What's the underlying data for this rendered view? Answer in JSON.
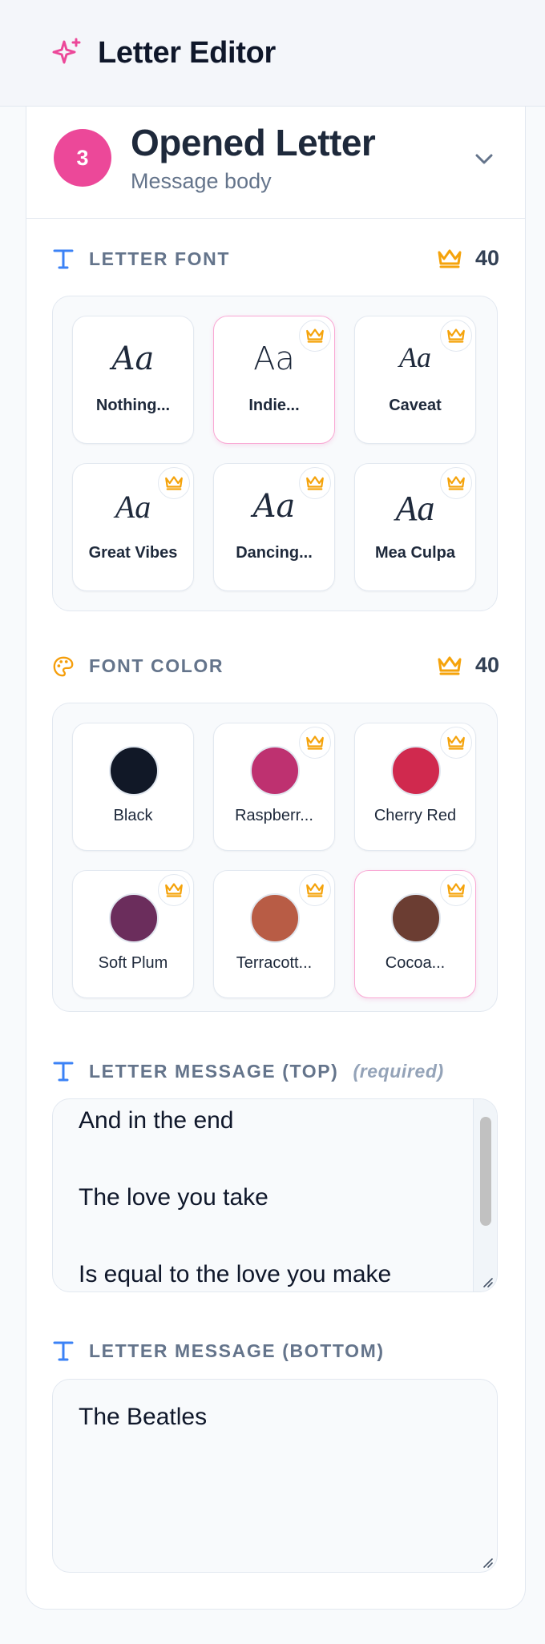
{
  "header": {
    "title": "Letter Editor"
  },
  "section": {
    "step": "3",
    "title": "Opened Letter",
    "subtitle": "Message body"
  },
  "font_group": {
    "label": "LETTER FONT",
    "cost": "40",
    "fonts": [
      {
        "sample": "Aa",
        "name": "Nothing...",
        "premium": false,
        "selected": false
      },
      {
        "sample": "Aa",
        "name": "Indie...",
        "premium": true,
        "selected": true
      },
      {
        "sample": "Aa",
        "name": "Caveat",
        "premium": true,
        "selected": false
      },
      {
        "sample": "Aa",
        "name": "Great Vibes",
        "premium": true,
        "selected": false
      },
      {
        "sample": "Aa",
        "name": "Dancing...",
        "premium": true,
        "selected": false
      },
      {
        "sample": "Aa",
        "name": "Mea Culpa",
        "premium": true,
        "selected": false
      }
    ]
  },
  "color_group": {
    "label": "FONT COLOR",
    "cost": "40",
    "colors": [
      {
        "name": "Black",
        "hex": "#111827",
        "premium": false,
        "selected": false
      },
      {
        "name": "Raspberr...",
        "hex": "#be3170",
        "premium": true,
        "selected": false
      },
      {
        "name": "Cherry Red",
        "hex": "#d0294e",
        "premium": true,
        "selected": false
      },
      {
        "name": "Soft Plum",
        "hex": "#6b2d5c",
        "premium": true,
        "selected": false
      },
      {
        "name": "Terracott...",
        "hex": "#b85c45",
        "premium": true,
        "selected": false
      },
      {
        "name": "Cocoa...",
        "hex": "#6b3d32",
        "premium": true,
        "selected": true
      }
    ]
  },
  "message_top": {
    "label": "LETTER MESSAGE (TOP)",
    "required": "(required)",
    "lines": [
      "And in the end",
      "",
      "The love you take",
      "",
      "Is equal to the love you make"
    ]
  },
  "message_bottom": {
    "label": "LETTER MESSAGE (BOTTOM)",
    "value": "The Beatles"
  },
  "colors": {
    "accent_pink": "#ec4899",
    "crown_gold": "#f5a30b",
    "label_icon_blue": "#3b82f6"
  }
}
